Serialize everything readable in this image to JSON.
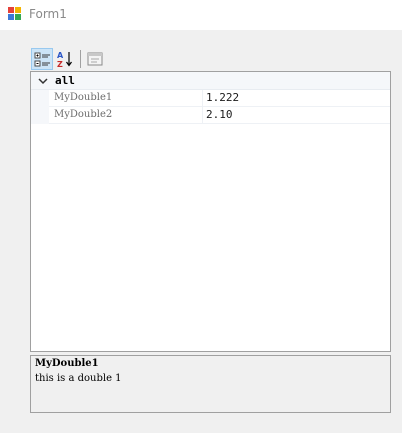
{
  "window": {
    "title": "Form1",
    "icon": "form-app-icon"
  },
  "toolbar": {
    "buttons": [
      {
        "name": "categorized",
        "icon": "categorized-view-icon",
        "active": true
      },
      {
        "name": "alphabetical",
        "icon": "sort-az-icon",
        "label": "AZ",
        "active": false
      },
      {
        "name": "property-pages",
        "icon": "property-pages-icon",
        "active": false
      }
    ]
  },
  "property_grid": {
    "categories": [
      {
        "label": "all",
        "expanded": true,
        "properties": [
          {
            "name": "MyDouble1",
            "value": "1.222"
          },
          {
            "name": "MyDouble2",
            "value": "2.10"
          }
        ]
      }
    ]
  },
  "help_pane": {
    "title": "MyDouble1",
    "description": "this is a double 1"
  },
  "colors": {
    "accent_selected": "#cce4f7",
    "border": "#a0a0a0",
    "client_bg": "#f0f0f0",
    "grid_gutter": "#f5f7fa"
  }
}
